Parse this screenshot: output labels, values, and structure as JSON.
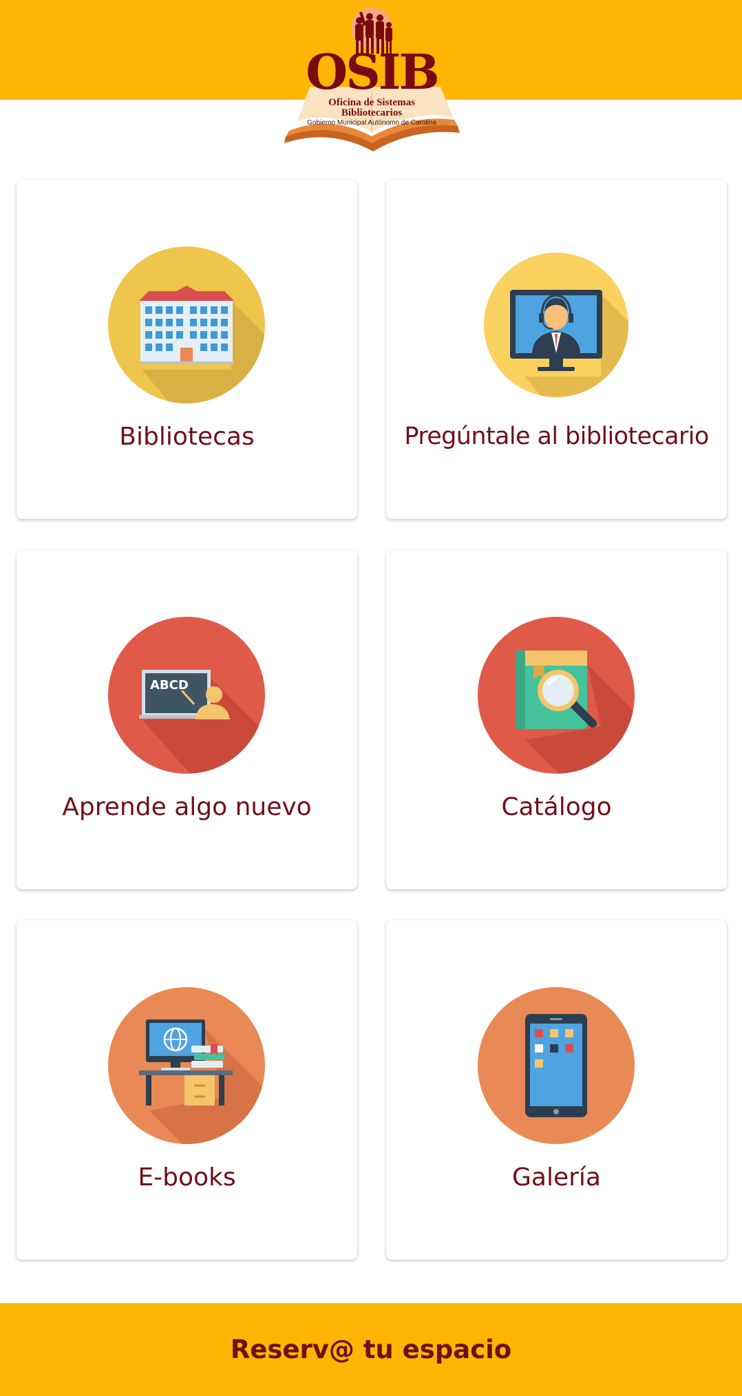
{
  "header": {
    "logo": {
      "title": "OSIB",
      "subtitle_line1": "Oficina de Sistemas",
      "subtitle_line2": "Bibliotecarios",
      "tagline": "Gobierno Municipal Autónomo de Carolina"
    },
    "color": "#FFB503"
  },
  "cards": [
    {
      "label": "Bibliotecas",
      "icon": "library-building-icon",
      "circle_color": "#EEC64C"
    },
    {
      "label": "Pregúntale al bibliotecario",
      "icon": "librarian-headset-icon",
      "circle_color": "#FBD15F"
    },
    {
      "label": "Aprende algo nuevo",
      "icon": "blackboard-teacher-icon",
      "circle_color": "#E05A49",
      "board_text": "ABCD"
    },
    {
      "label": "Catálogo",
      "icon": "book-magnifier-icon",
      "circle_color": "#E05A49"
    },
    {
      "label": "E-books",
      "icon": "computer-desk-books-icon",
      "circle_color": "#E98955"
    },
    {
      "label": "Galería",
      "icon": "smartphone-icon",
      "circle_color": "#E98955"
    }
  ],
  "footer": {
    "label": "Reserv@ tu espacio",
    "color": "#FFB503"
  },
  "colors": {
    "text": "#6e1116",
    "accent": "#FFB503",
    "background": "#ffffff"
  }
}
